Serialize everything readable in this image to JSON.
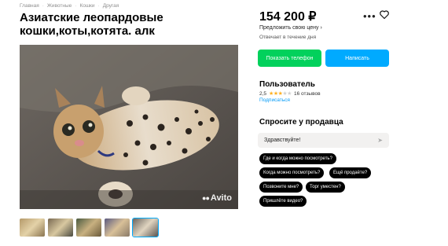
{
  "breadcrumb": [
    "Главная",
    "Животные",
    "Кошки",
    "Другая"
  ],
  "listing": {
    "title": "Азиатские леопардовые кошки,коты,котята. алк",
    "price": "154 200 ₽",
    "offer_price_label": "Предложить свою цену",
    "reply_time": "Отвечает в течение дня"
  },
  "buttons": {
    "show_phone": "Показать телефон",
    "write": "Написать"
  },
  "seller": {
    "name": "Пользователь",
    "rating": "2,5",
    "stars_filled": 2.5,
    "stars_total": 5,
    "reviews": "16 отзывов",
    "subscribe": "Подписаться"
  },
  "ask": {
    "title": "Спросите у продавца",
    "input_value": "Здравствуйте!",
    "quick_questions": [
      "Где и когда можно посмотреть?",
      "Когда можно посмотреть?",
      "Ещё продаёте?",
      "Позвоните мне?",
      "Торг уместен?",
      "Пришлёте видео?"
    ]
  },
  "photo": {
    "watermark": "Avito",
    "thumbnail_count": 5,
    "active_thumbnail": 5
  },
  "colors": {
    "green_button": "#02d15c",
    "blue_button": "#00aaff",
    "link": "#0099f7"
  }
}
